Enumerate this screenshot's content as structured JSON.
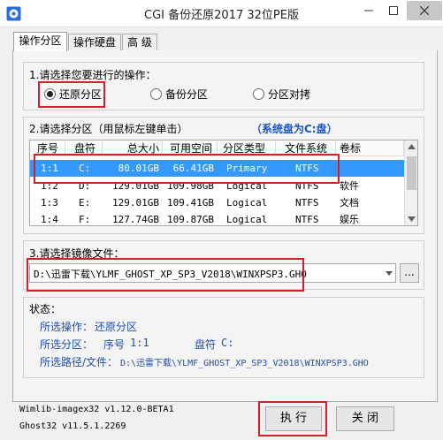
{
  "window": {
    "title": "CGI 备份还原2017 32位PE版"
  },
  "tabs": [
    {
      "label": "操作分区",
      "active": true
    },
    {
      "label": "操作硬盘",
      "active": false
    },
    {
      "label": "高 级",
      "active": false
    }
  ],
  "operation": {
    "prompt": "1.请选择您要进行的操作：",
    "options": [
      {
        "label": "还原分区",
        "selected": true
      },
      {
        "label": "备份分区",
        "selected": false
      },
      {
        "label": "分区对拷",
        "selected": false
      }
    ]
  },
  "partition": {
    "prompt": "2.请选择分区（用鼠标左键单击）",
    "system_disk_note": "（系统盘为C:盘）",
    "columns": [
      "序号",
      "盘符",
      "总大小",
      "可用空间",
      "分区类型",
      "文件系统",
      "卷标"
    ],
    "rows": [
      {
        "index": "1:1",
        "drive": "C:",
        "total": "80.01GB",
        "free": "66.41GB",
        "type": "Primary",
        "fs": "NTFS",
        "label": "",
        "selected": true
      },
      {
        "index": "1:2",
        "drive": "D:",
        "total": "129.01GB",
        "free": "109.98GB",
        "type": "Logical",
        "fs": "NTFS",
        "label": "软件",
        "selected": false
      },
      {
        "index": "1:3",
        "drive": "E:",
        "total": "129.01GB",
        "free": "109.41GB",
        "type": "Logical",
        "fs": "NTFS",
        "label": "文档",
        "selected": false
      },
      {
        "index": "1:4",
        "drive": "F:",
        "total": "127.74GB",
        "free": "109.87GB",
        "type": "Logical",
        "fs": "NTFS",
        "label": "娱乐",
        "selected": false
      }
    ]
  },
  "image_file": {
    "prompt": "3.请选择镜像文件：",
    "value": "D:\\迅雷下载\\YLMF_GHOST_XP_SP3_V2018\\WINXPSP3.GHO",
    "browse_label": "..."
  },
  "status": {
    "title": "状态：",
    "operation_label": "所选操作：",
    "operation_value": "还原分区",
    "partition_label": "所选分区：",
    "seq_label": "序号",
    "seq_value": "1:1",
    "drive_label": "盘符",
    "drive_value": "C:",
    "path_label": "所选路径/文件：",
    "path_value": "D:\\迅雷下载\\YLMF_GHOST_XP_SP3_V2018\\WINXPSP3.GHO"
  },
  "footer": {
    "version_1": "Wimlib-imagex32 v1.12.0-BETA1",
    "version_2": "Ghost32 v11.5.1.2269",
    "execute_label": "执 行",
    "close_label": "关 闭"
  },
  "colors": {
    "highlight": "#d4202a",
    "selection": "#3399ff",
    "status_text": "#1e4eb0",
    "note_text": "#1a56c4"
  }
}
